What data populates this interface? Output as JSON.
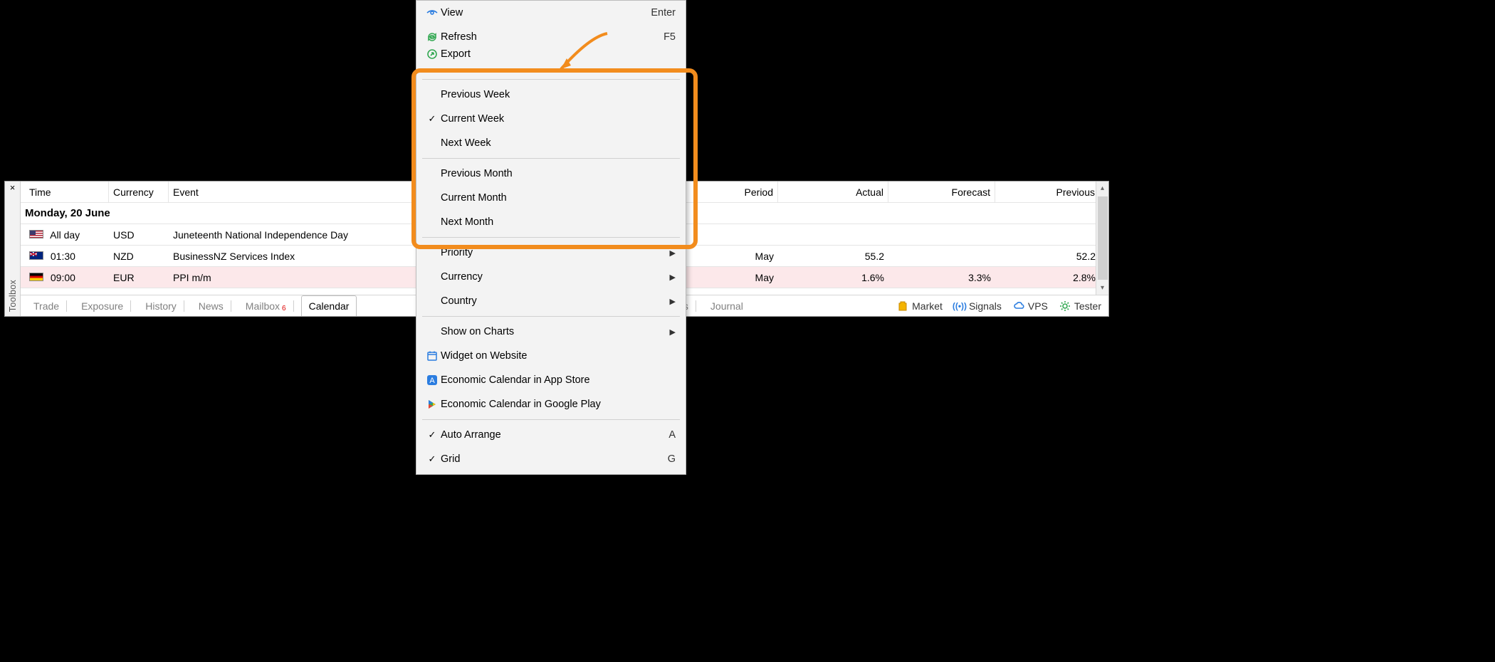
{
  "panel": {
    "title": "Toolbox",
    "close": "×"
  },
  "grid": {
    "headers": {
      "time": "Time",
      "currency": "Currency",
      "event": "Event",
      "period": "Period",
      "actual": "Actual",
      "forecast": "Forecast",
      "previous": "Previous"
    },
    "group": "Monday, 20 June",
    "rows": [
      {
        "flag": "us",
        "time": "All day",
        "currency": "USD",
        "event": "Juneteenth National Independence Day",
        "period": "",
        "actual": "",
        "forecast": "",
        "previous": ""
      },
      {
        "flag": "nz",
        "time": "01:30",
        "currency": "NZD",
        "event": "BusinessNZ Services Index",
        "period": "May",
        "actual": "55.2",
        "forecast": "",
        "previous": "52.2",
        "prev_dotted": true
      },
      {
        "flag": "de",
        "time": "09:00",
        "currency": "EUR",
        "event": "PPI m/m",
        "period": "May",
        "actual": "1.6%",
        "forecast": "3.3%",
        "previous": "2.8%",
        "highlight": true
      }
    ]
  },
  "tabs": {
    "left": [
      "Trade",
      "Exposure",
      "History",
      "News",
      "Mailbox"
    ],
    "mailbox_badge": "6",
    "active": "Calendar",
    "right": [
      "Experts",
      "Journal"
    ]
  },
  "status": {
    "market": "Market",
    "signals": "Signals",
    "vps": "VPS",
    "tester": "Tester"
  },
  "menu": {
    "view": {
      "label": "View",
      "shortcut": "Enter"
    },
    "refresh": {
      "label": "Refresh",
      "shortcut": "F5"
    },
    "export": {
      "label": "Export"
    },
    "prev_week": "Previous Week",
    "cur_week": "Current Week",
    "next_week": "Next Week",
    "prev_month": "Previous Month",
    "cur_month": "Current Month",
    "next_month": "Next Month",
    "priority": "Priority",
    "currency": "Currency",
    "country": "Country",
    "show_charts": "Show on Charts",
    "widget": "Widget on Website",
    "appstore": "Economic Calendar in App Store",
    "play": "Economic Calendar in Google Play",
    "auto_arrange": {
      "label": "Auto Arrange",
      "shortcut": "A"
    },
    "grid": {
      "label": "Grid",
      "shortcut": "G"
    }
  }
}
